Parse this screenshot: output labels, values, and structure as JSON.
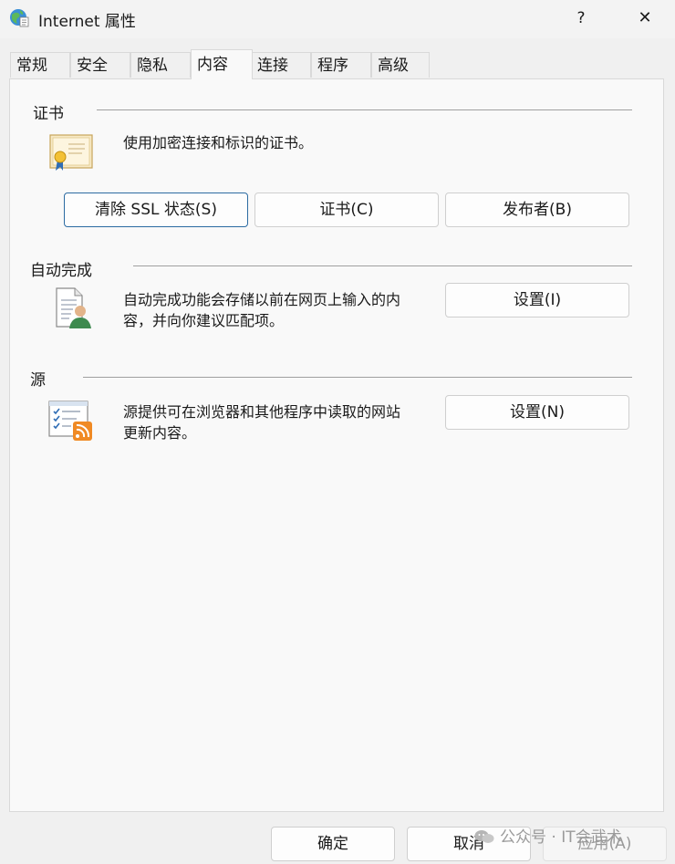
{
  "window": {
    "title": "Internet 属性",
    "help": "?",
    "close": "✕"
  },
  "tabs": [
    "常规",
    "安全",
    "隐私",
    "内容",
    "连接",
    "程序",
    "高级"
  ],
  "active_tab": "内容",
  "certificates": {
    "label": "证书",
    "description": "使用加密连接和标识的证书。",
    "buttons": [
      "清除 SSL 状态(S)",
      "证书(C)",
      "发布者(B)"
    ]
  },
  "autocomplete": {
    "label": "自动完成",
    "description_line1": "自动完成功能会存储以前在网页上输入的内",
    "description_line2": "容，并向你建议匹配项。",
    "button": "设置(I)"
  },
  "feeds": {
    "label": "源",
    "description_line1": "源提供可在浏览器和其他程序中读取的网站",
    "description_line2": "更新内容。",
    "button": "设置(N)"
  },
  "footer": {
    "ok": "确定",
    "cancel": "取消",
    "apply": "应用(A)"
  },
  "watermark": "公众号 · IT会武术",
  "colors": {
    "focus_border": "#2b6aa1",
    "panel_bg": "#f9f9f9",
    "window_bg": "#f0f0f0"
  }
}
